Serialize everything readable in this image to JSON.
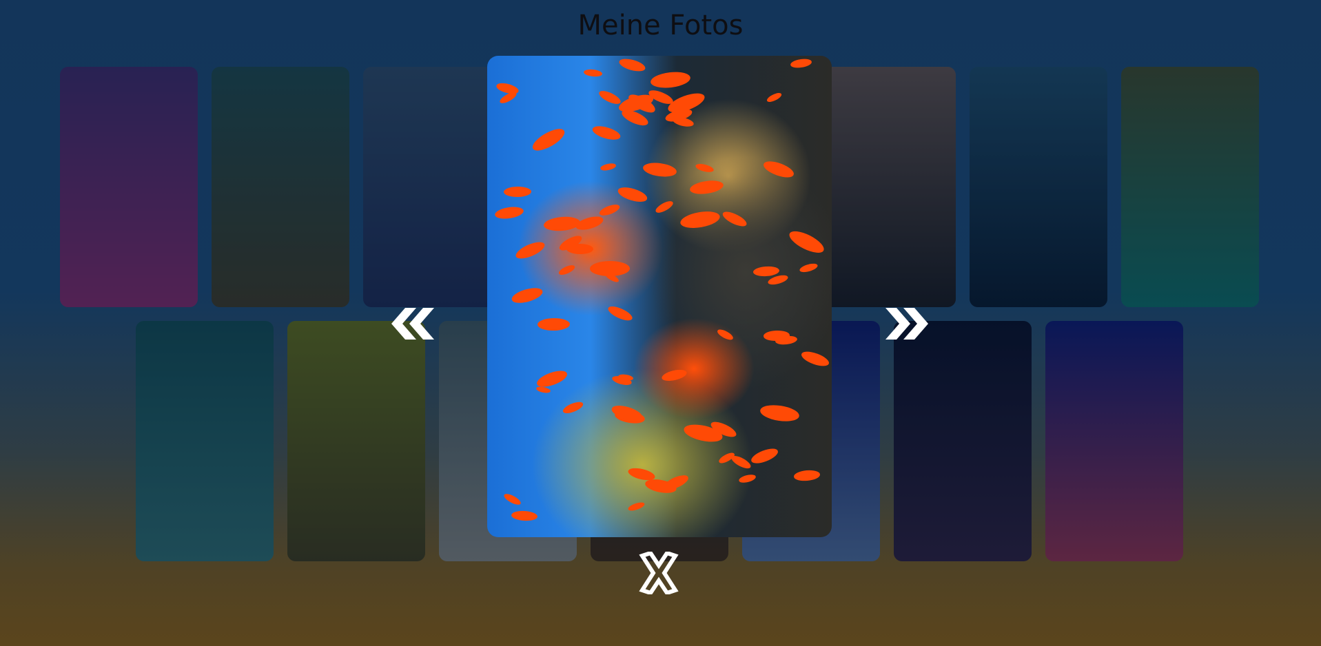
{
  "page": {
    "title": "Meine Fotos"
  },
  "gallery": {
    "row1": [
      {
        "name": "coral-reef-purple",
        "colors": [
          "#3a2a6a",
          "#7a2a6a"
        ]
      },
      {
        "name": "underwater-reef-green",
        "colors": [
          "#1b4850",
          "#3a3a2a"
        ]
      },
      {
        "name": "school-of-fish",
        "colors": [
          "#2a4a6a",
          "#1a2a55"
        ]
      },
      {
        "name": "hidden-card",
        "colors": [
          "#2a4a6a",
          "#1a2a55"
        ]
      },
      {
        "name": "hidden-card-2",
        "colors": [
          "#2a4a6a",
          "#1a2a55"
        ]
      },
      {
        "name": "orca",
        "colors": [
          "#5a5050",
          "#151a22"
        ]
      },
      {
        "name": "fish-spiral",
        "colors": [
          "#1a4a6a",
          "#061a30"
        ]
      },
      {
        "name": "waterfall",
        "colors": [
          "#3a4a30",
          "#0a6a68"
        ]
      }
    ],
    "row2": [
      {
        "name": "sea-floor-starfish",
        "colors": [
          "#0f4a55",
          "#2a6a70"
        ]
      },
      {
        "name": "clownfish-anemone",
        "colors": [
          "#5a6a20",
          "#3a3a20"
        ]
      },
      {
        "name": "sandy-bottom-fish",
        "colors": [
          "#3a5560",
          "#7a8080"
        ]
      },
      {
        "name": "coral-below",
        "colors": [
          "#1a2a30",
          "#3a2a1a"
        ]
      },
      {
        "name": "underwater-scene-blue",
        "colors": [
          "#0a1a6a",
          "#4a6a9a"
        ]
      },
      {
        "name": "jellyfish",
        "colors": [
          "#06102a",
          "#2a2040"
        ]
      },
      {
        "name": "pink-fish",
        "colors": [
          "#0a1a70",
          "#8a3050"
        ]
      }
    ]
  },
  "lightbox": {
    "image": "coral-reef-orange-fish",
    "prev_label": "«",
    "next_label": "»",
    "close_label": "✕"
  }
}
